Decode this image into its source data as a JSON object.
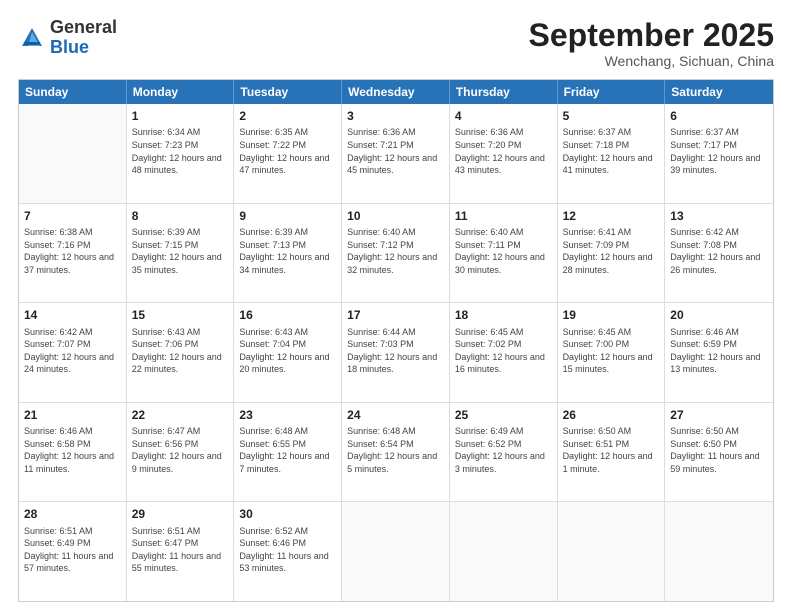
{
  "header": {
    "logo_general": "General",
    "logo_blue": "Blue",
    "month_title": "September 2025",
    "location": "Wenchang, Sichuan, China"
  },
  "days_of_week": [
    "Sunday",
    "Monday",
    "Tuesday",
    "Wednesday",
    "Thursday",
    "Friday",
    "Saturday"
  ],
  "weeks": [
    [
      {
        "day": "",
        "sunrise": "",
        "sunset": "",
        "daylight": ""
      },
      {
        "day": "1",
        "sunrise": "Sunrise: 6:34 AM",
        "sunset": "Sunset: 7:23 PM",
        "daylight": "Daylight: 12 hours and 48 minutes."
      },
      {
        "day": "2",
        "sunrise": "Sunrise: 6:35 AM",
        "sunset": "Sunset: 7:22 PM",
        "daylight": "Daylight: 12 hours and 47 minutes."
      },
      {
        "day": "3",
        "sunrise": "Sunrise: 6:36 AM",
        "sunset": "Sunset: 7:21 PM",
        "daylight": "Daylight: 12 hours and 45 minutes."
      },
      {
        "day": "4",
        "sunrise": "Sunrise: 6:36 AM",
        "sunset": "Sunset: 7:20 PM",
        "daylight": "Daylight: 12 hours and 43 minutes."
      },
      {
        "day": "5",
        "sunrise": "Sunrise: 6:37 AM",
        "sunset": "Sunset: 7:18 PM",
        "daylight": "Daylight: 12 hours and 41 minutes."
      },
      {
        "day": "6",
        "sunrise": "Sunrise: 6:37 AM",
        "sunset": "Sunset: 7:17 PM",
        "daylight": "Daylight: 12 hours and 39 minutes."
      }
    ],
    [
      {
        "day": "7",
        "sunrise": "Sunrise: 6:38 AM",
        "sunset": "Sunset: 7:16 PM",
        "daylight": "Daylight: 12 hours and 37 minutes."
      },
      {
        "day": "8",
        "sunrise": "Sunrise: 6:39 AM",
        "sunset": "Sunset: 7:15 PM",
        "daylight": "Daylight: 12 hours and 35 minutes."
      },
      {
        "day": "9",
        "sunrise": "Sunrise: 6:39 AM",
        "sunset": "Sunset: 7:13 PM",
        "daylight": "Daylight: 12 hours and 34 minutes."
      },
      {
        "day": "10",
        "sunrise": "Sunrise: 6:40 AM",
        "sunset": "Sunset: 7:12 PM",
        "daylight": "Daylight: 12 hours and 32 minutes."
      },
      {
        "day": "11",
        "sunrise": "Sunrise: 6:40 AM",
        "sunset": "Sunset: 7:11 PM",
        "daylight": "Daylight: 12 hours and 30 minutes."
      },
      {
        "day": "12",
        "sunrise": "Sunrise: 6:41 AM",
        "sunset": "Sunset: 7:09 PM",
        "daylight": "Daylight: 12 hours and 28 minutes."
      },
      {
        "day": "13",
        "sunrise": "Sunrise: 6:42 AM",
        "sunset": "Sunset: 7:08 PM",
        "daylight": "Daylight: 12 hours and 26 minutes."
      }
    ],
    [
      {
        "day": "14",
        "sunrise": "Sunrise: 6:42 AM",
        "sunset": "Sunset: 7:07 PM",
        "daylight": "Daylight: 12 hours and 24 minutes."
      },
      {
        "day": "15",
        "sunrise": "Sunrise: 6:43 AM",
        "sunset": "Sunset: 7:06 PM",
        "daylight": "Daylight: 12 hours and 22 minutes."
      },
      {
        "day": "16",
        "sunrise": "Sunrise: 6:43 AM",
        "sunset": "Sunset: 7:04 PM",
        "daylight": "Daylight: 12 hours and 20 minutes."
      },
      {
        "day": "17",
        "sunrise": "Sunrise: 6:44 AM",
        "sunset": "Sunset: 7:03 PM",
        "daylight": "Daylight: 12 hours and 18 minutes."
      },
      {
        "day": "18",
        "sunrise": "Sunrise: 6:45 AM",
        "sunset": "Sunset: 7:02 PM",
        "daylight": "Daylight: 12 hours and 16 minutes."
      },
      {
        "day": "19",
        "sunrise": "Sunrise: 6:45 AM",
        "sunset": "Sunset: 7:00 PM",
        "daylight": "Daylight: 12 hours and 15 minutes."
      },
      {
        "day": "20",
        "sunrise": "Sunrise: 6:46 AM",
        "sunset": "Sunset: 6:59 PM",
        "daylight": "Daylight: 12 hours and 13 minutes."
      }
    ],
    [
      {
        "day": "21",
        "sunrise": "Sunrise: 6:46 AM",
        "sunset": "Sunset: 6:58 PM",
        "daylight": "Daylight: 12 hours and 11 minutes."
      },
      {
        "day": "22",
        "sunrise": "Sunrise: 6:47 AM",
        "sunset": "Sunset: 6:56 PM",
        "daylight": "Daylight: 12 hours and 9 minutes."
      },
      {
        "day": "23",
        "sunrise": "Sunrise: 6:48 AM",
        "sunset": "Sunset: 6:55 PM",
        "daylight": "Daylight: 12 hours and 7 minutes."
      },
      {
        "day": "24",
        "sunrise": "Sunrise: 6:48 AM",
        "sunset": "Sunset: 6:54 PM",
        "daylight": "Daylight: 12 hours and 5 minutes."
      },
      {
        "day": "25",
        "sunrise": "Sunrise: 6:49 AM",
        "sunset": "Sunset: 6:52 PM",
        "daylight": "Daylight: 12 hours and 3 minutes."
      },
      {
        "day": "26",
        "sunrise": "Sunrise: 6:50 AM",
        "sunset": "Sunset: 6:51 PM",
        "daylight": "Daylight: 12 hours and 1 minute."
      },
      {
        "day": "27",
        "sunrise": "Sunrise: 6:50 AM",
        "sunset": "Sunset: 6:50 PM",
        "daylight": "Daylight: 11 hours and 59 minutes."
      }
    ],
    [
      {
        "day": "28",
        "sunrise": "Sunrise: 6:51 AM",
        "sunset": "Sunset: 6:49 PM",
        "daylight": "Daylight: 11 hours and 57 minutes."
      },
      {
        "day": "29",
        "sunrise": "Sunrise: 6:51 AM",
        "sunset": "Sunset: 6:47 PM",
        "daylight": "Daylight: 11 hours and 55 minutes."
      },
      {
        "day": "30",
        "sunrise": "Sunrise: 6:52 AM",
        "sunset": "Sunset: 6:46 PM",
        "daylight": "Daylight: 11 hours and 53 minutes."
      },
      {
        "day": "",
        "sunrise": "",
        "sunset": "",
        "daylight": ""
      },
      {
        "day": "",
        "sunrise": "",
        "sunset": "",
        "daylight": ""
      },
      {
        "day": "",
        "sunrise": "",
        "sunset": "",
        "daylight": ""
      },
      {
        "day": "",
        "sunrise": "",
        "sunset": "",
        "daylight": ""
      }
    ]
  ]
}
